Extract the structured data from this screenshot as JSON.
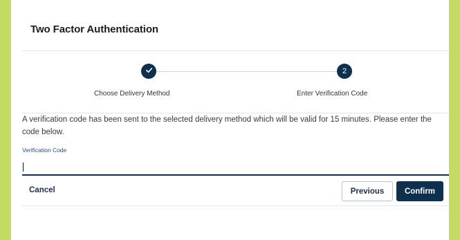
{
  "header": {
    "title": "Two Factor Authentication"
  },
  "stepper": {
    "steps": [
      {
        "label": "Choose Delivery Method",
        "state": "complete",
        "icon": "check-icon"
      },
      {
        "label": "Enter Verification Code",
        "state": "current",
        "number": "2"
      }
    ]
  },
  "message": "A verification code has been sent to the selected delivery method which will be valid for 15 minutes. Please enter the code below.",
  "field": {
    "label": "Verification Code",
    "value": ""
  },
  "footer": {
    "cancel_label": "Cancel",
    "previous_label": "Previous",
    "confirm_label": "Confirm"
  },
  "colors": {
    "background": "#c3db62",
    "primary": "#0e2f4e",
    "link": "#1f4f82"
  }
}
